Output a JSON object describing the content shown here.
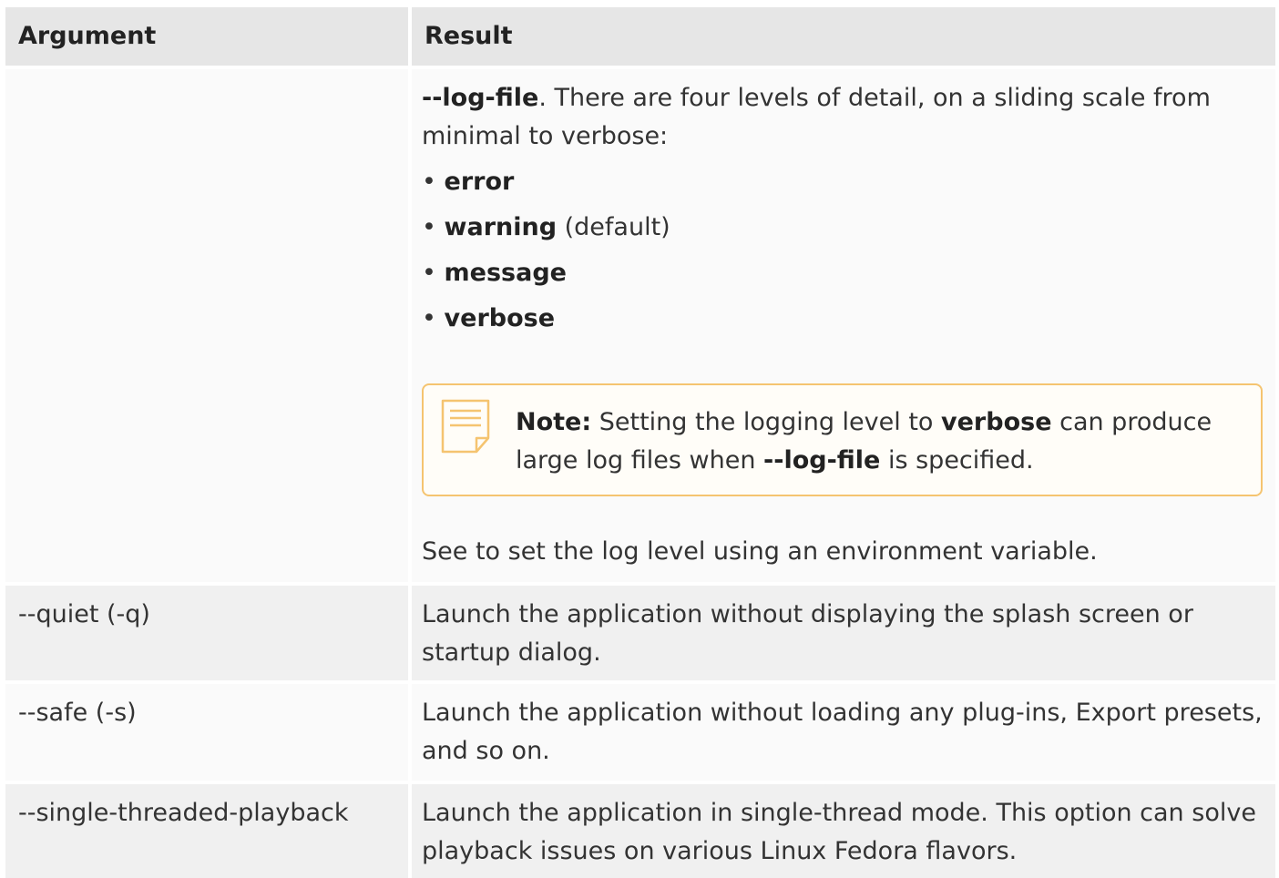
{
  "header": {
    "col1": "Argument",
    "col2": "Result"
  },
  "log_row": {
    "intro_bold": "--log-file",
    "intro_rest": ". There are four levels of detail, on a sliding scale from minimal to verbose:",
    "levels": [
      {
        "bullet": "•",
        "name": "error",
        "suffix": ""
      },
      {
        "bullet": "•",
        "name": "warning",
        "suffix": " (default)"
      },
      {
        "bullet": "•",
        "name": "message",
        "suffix": ""
      },
      {
        "bullet": "•",
        "name": "verbose",
        "suffix": ""
      }
    ],
    "note": {
      "icon": "note-icon",
      "label": "Note:",
      "text_1": " Setting the logging level to ",
      "bold_1": "verbose",
      "text_2": " can produce large log files when ",
      "bold_2": "--log-file",
      "text_3": " is specified."
    },
    "footer": "See to set the log level using an environment variable."
  },
  "rows": [
    {
      "argument": "--quiet (-q)",
      "result": "Launch the application without displaying the splash screen or startup dialog."
    },
    {
      "argument": "--safe (-s)",
      "result": "Launch the application without loading any plug-ins, Export presets, and so on."
    },
    {
      "argument": "--single-threaded-playback",
      "result": "Launch the application in single-thread mode. This option can solve playback issues on various Linux Fedora flavors."
    }
  ],
  "colors": {
    "header_bg": "#e6e6e6",
    "row_light": "#fafafa",
    "row_gray": "#f0f0f0",
    "note_border": "#f5c470"
  }
}
